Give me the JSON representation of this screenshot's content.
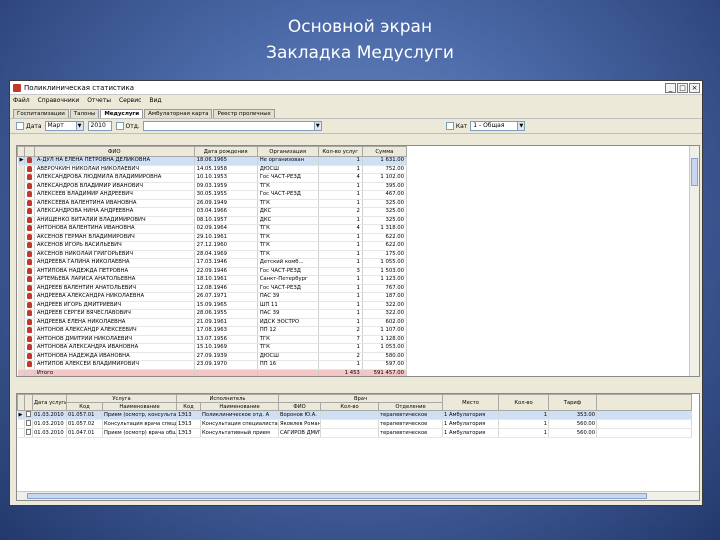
{
  "slide": {
    "title_line1": "Основной экран",
    "title_line2": "Закладка Медуслуги"
  },
  "window": {
    "title": "Поликлиническая статистика",
    "btn_min": "_",
    "btn_max": "□",
    "btn_close": "×"
  },
  "menu": [
    "Файл",
    "Справочники",
    "Отчеты",
    "Сервис",
    "Вид"
  ],
  "tabs": [
    "Госпитализации",
    "Талоны",
    "Медуслуги",
    "Амбулаторная карта",
    "Реестр пролечных"
  ],
  "filter": {
    "label_date": "Дата",
    "period": "Март",
    "year": "2010",
    "label_dept": "Отд.",
    "label_cat": "Кат",
    "cat_value": "1 - Общая"
  },
  "patients": {
    "columns": [
      "ФИО",
      "Дата рождения",
      "Организация",
      "Кол-во услуг",
      "Сумма"
    ],
    "rows": [
      [
        "А-ДУЛ НА ЕЛЕНА ПЕТРОВНА ДЕЛИКОВНА",
        "18.06.1965",
        "Не организован",
        "1",
        "1 631.00"
      ],
      [
        "АВЕРОЧКИН НИКОЛАЙ НИКОЛАЕВИЧ",
        "14.05.1958",
        "ДЮСШ",
        "1",
        "752.00"
      ],
      [
        "АЛЕКСАНДРОВА ЛЮДМИЛА ВЛАДИМИРОВНА",
        "10.10.1953",
        "Гос ЧАСТ-РЕЗД",
        "4",
        "1 102.00"
      ],
      [
        "АЛЕКСАНДРОВ ВЛАДИМИР ИВАНОВИЧ",
        "09.03.1959",
        "ТГК",
        "1",
        "395.00"
      ],
      [
        "АЛЕКСЕЕВ ВЛАДИМИР АНДРЕЕВИЧ",
        "30.05.1955",
        "Гос ЧАСТ-РЕЗД",
        "1",
        "467.00"
      ],
      [
        "АЛЕКСЕЕВА ВАЛЕНТИНА ИВАНОВНА",
        "26.09.1949",
        "ТГК",
        "1",
        "325.00"
      ],
      [
        "АЛЕКСАНДРОВА НИНА АНДРЕЕВНА",
        "03.04.1966",
        "ДКС",
        "2",
        "325.00"
      ],
      [
        "АНИЩЕНКО ВИТАЛИЙ ВЛАДИМИРОВИЧ",
        "08.10.1957",
        "ДКС",
        "1",
        "325.00"
      ],
      [
        "АНТОНОВА ВАЛЕНТИНА ИВАНОВНА",
        "02.09.1964",
        "ТГК",
        "4",
        "1 318.00"
      ],
      [
        "АКСЕНОВ ГЕРМАН ВЛАДИМИРОВИЧ",
        "29.10.1961",
        "ТГК",
        "1",
        "622.00"
      ],
      [
        "АКСЕНОВ ИГОРЬ ВАСИЛЬЕВИЧ",
        "27.12.1960",
        "ТГК",
        "1",
        "622.00"
      ],
      [
        "АКСЕНОВ НИКОЛАЙ ГРИГОРЬЕВИЧ",
        "28.04.1969",
        "ТГК",
        "1",
        "175.00"
      ],
      [
        "АНДРЕЕВА ГАЛИНА НИКОЛАЕВНА",
        "17.03.1946",
        "Детский комб...",
        "1",
        "1 055.00"
      ],
      [
        "АНТИПОВА НАДЕЖДА ПЕТРОВНА",
        "22.09.1946",
        "Гос ЧАСТ-РЕЗД",
        "3",
        "1 503.00"
      ],
      [
        "АРТЕМЬЕВА ЛАРИСА АНАТОЛЬЕВНА",
        "18.10.1961",
        "Санкт-Петербург",
        "1",
        "1 123.00"
      ],
      [
        "АНДРЕЕВ ВАЛЕНТИН АНАТОЛЬЕВИЧ",
        "12.08.1946",
        "Гос ЧАСТ-РЕЗД",
        "1",
        "767.00"
      ],
      [
        "АНДРЕЕВА АЛЕКСАНДРА НИКОЛАЕВНА",
        "26.07.1971",
        "ПАС 39",
        "1",
        "187.00"
      ],
      [
        "АНДРЕЕВ ИГОРЬ ДМИТРИЕВИЧ",
        "15.09.1965",
        "ШП 11",
        "1",
        "322.00"
      ],
      [
        "АНДРЕЕВ СЕРГЕЙ ВЯЧЕСЛАВОВИЧ",
        "28.06.1955",
        "ПАС 39",
        "1",
        "322.00"
      ],
      [
        "АНДРЕЕВА ЕЛЕНА НИКОЛАЕВНА",
        "21.09.1961",
        "ИДСК ЭОСТРО",
        "1",
        "602.00"
      ],
      [
        "АНТОНОВ АЛЕКСАНДР АЛЕКСЕЕВИЧ",
        "17.08.1963",
        "ПП 12",
        "2",
        "1 107.00"
      ],
      [
        "АНТОНОВ ДМИТРИЙ НИКОЛАЕВИЧ",
        "13.07.1956",
        "ТГК",
        "7",
        "1 128.00"
      ],
      [
        "АНТОНОВА АЛЕКСАНДРА ИВАНОВНА",
        "15.10.1969",
        "ТГК",
        "1",
        "1 053.00"
      ],
      [
        "АНТОНОВА НАДЕЖДА ИВАНОВНА",
        "27.09.1939",
        "ДЮСШ",
        "2",
        "580.00"
      ],
      [
        "АНТИПОВ АЛЕКСЕЙ ВЛАДИМИРОВИЧ",
        "23.09.1970",
        "ПП 16",
        "1",
        "597.00"
      ]
    ],
    "total_label": "Итого",
    "total_count": "1 453",
    "total_sum": "591 457.00"
  },
  "services": {
    "group_headers": {
      "date": "Дата услуги",
      "service": "Услуга",
      "executor": "Исполнитель",
      "doctor": "Врач",
      "place": "Место",
      "qty": "Кол-во",
      "tariff": "Тариф"
    },
    "columns": [
      "Код",
      "Наименование",
      "Код",
      "Наименование",
      "ФИО",
      "Кол-во",
      "Отделение"
    ],
    "rows": [
      [
        "01.03.2010",
        "01.057.01",
        "Прием (осмотр, консультация)",
        "1Э13",
        "Поликлиническое отд. А",
        "Воронов Ю.А.",
        "терапевтическое",
        "1 Амбулатория",
        "1",
        "353.00"
      ],
      [
        "01.03.2010",
        "01.057.02",
        "Консультация врача специалиста",
        "1Э13",
        "Консультация специалиста",
        "Яковлев Роман",
        "терапевтическое",
        "1 Амбулатория",
        "1",
        "560.00"
      ],
      [
        "01.03.2010",
        "01.047.01",
        "Прием (осмотр) врача общей практики",
        "1Э13",
        "Консультативный прием",
        "САГИРОВ ДМИТРИЙ",
        "терапевтическое",
        "1 Амбулатория",
        "1",
        "560.00"
      ]
    ]
  }
}
